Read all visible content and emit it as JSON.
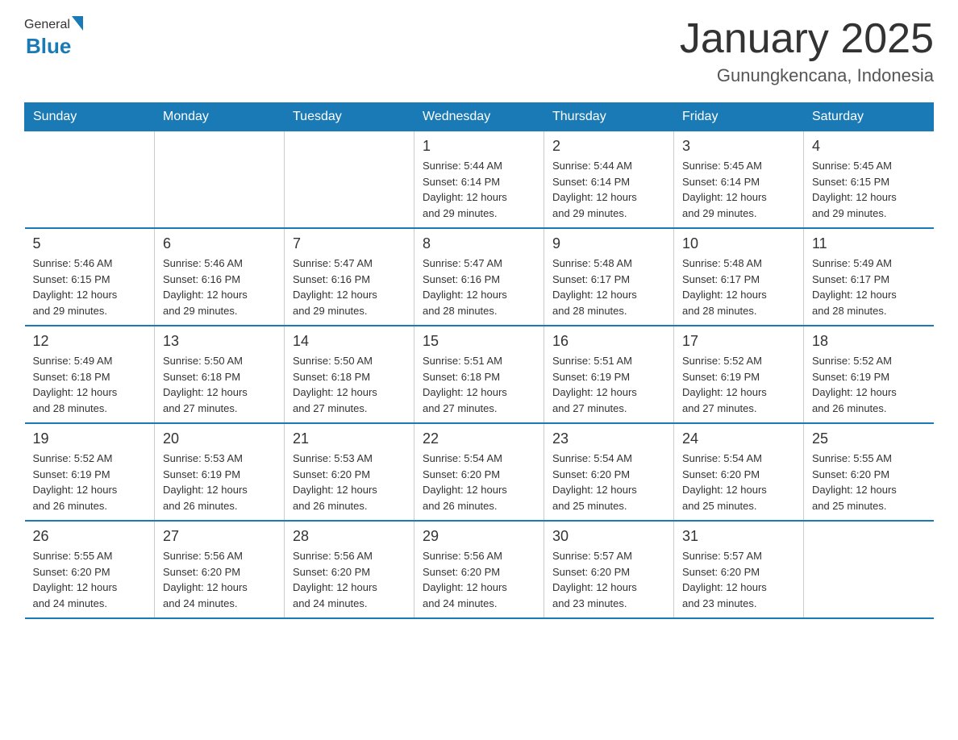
{
  "header": {
    "logo": {
      "general": "General",
      "arrow": true,
      "blue": "Blue"
    },
    "title": "January 2025",
    "location": "Gunungkencana, Indonesia"
  },
  "calendar": {
    "days_of_week": [
      "Sunday",
      "Monday",
      "Tuesday",
      "Wednesday",
      "Thursday",
      "Friday",
      "Saturday"
    ],
    "weeks": [
      [
        {
          "day": "",
          "info": ""
        },
        {
          "day": "",
          "info": ""
        },
        {
          "day": "",
          "info": ""
        },
        {
          "day": "1",
          "info": "Sunrise: 5:44 AM\nSunset: 6:14 PM\nDaylight: 12 hours\nand 29 minutes."
        },
        {
          "day": "2",
          "info": "Sunrise: 5:44 AM\nSunset: 6:14 PM\nDaylight: 12 hours\nand 29 minutes."
        },
        {
          "day": "3",
          "info": "Sunrise: 5:45 AM\nSunset: 6:14 PM\nDaylight: 12 hours\nand 29 minutes."
        },
        {
          "day": "4",
          "info": "Sunrise: 5:45 AM\nSunset: 6:15 PM\nDaylight: 12 hours\nand 29 minutes."
        }
      ],
      [
        {
          "day": "5",
          "info": "Sunrise: 5:46 AM\nSunset: 6:15 PM\nDaylight: 12 hours\nand 29 minutes."
        },
        {
          "day": "6",
          "info": "Sunrise: 5:46 AM\nSunset: 6:16 PM\nDaylight: 12 hours\nand 29 minutes."
        },
        {
          "day": "7",
          "info": "Sunrise: 5:47 AM\nSunset: 6:16 PM\nDaylight: 12 hours\nand 29 minutes."
        },
        {
          "day": "8",
          "info": "Sunrise: 5:47 AM\nSunset: 6:16 PM\nDaylight: 12 hours\nand 28 minutes."
        },
        {
          "day": "9",
          "info": "Sunrise: 5:48 AM\nSunset: 6:17 PM\nDaylight: 12 hours\nand 28 minutes."
        },
        {
          "day": "10",
          "info": "Sunrise: 5:48 AM\nSunset: 6:17 PM\nDaylight: 12 hours\nand 28 minutes."
        },
        {
          "day": "11",
          "info": "Sunrise: 5:49 AM\nSunset: 6:17 PM\nDaylight: 12 hours\nand 28 minutes."
        }
      ],
      [
        {
          "day": "12",
          "info": "Sunrise: 5:49 AM\nSunset: 6:18 PM\nDaylight: 12 hours\nand 28 minutes."
        },
        {
          "day": "13",
          "info": "Sunrise: 5:50 AM\nSunset: 6:18 PM\nDaylight: 12 hours\nand 27 minutes."
        },
        {
          "day": "14",
          "info": "Sunrise: 5:50 AM\nSunset: 6:18 PM\nDaylight: 12 hours\nand 27 minutes."
        },
        {
          "day": "15",
          "info": "Sunrise: 5:51 AM\nSunset: 6:18 PM\nDaylight: 12 hours\nand 27 minutes."
        },
        {
          "day": "16",
          "info": "Sunrise: 5:51 AM\nSunset: 6:19 PM\nDaylight: 12 hours\nand 27 minutes."
        },
        {
          "day": "17",
          "info": "Sunrise: 5:52 AM\nSunset: 6:19 PM\nDaylight: 12 hours\nand 27 minutes."
        },
        {
          "day": "18",
          "info": "Sunrise: 5:52 AM\nSunset: 6:19 PM\nDaylight: 12 hours\nand 26 minutes."
        }
      ],
      [
        {
          "day": "19",
          "info": "Sunrise: 5:52 AM\nSunset: 6:19 PM\nDaylight: 12 hours\nand 26 minutes."
        },
        {
          "day": "20",
          "info": "Sunrise: 5:53 AM\nSunset: 6:19 PM\nDaylight: 12 hours\nand 26 minutes."
        },
        {
          "day": "21",
          "info": "Sunrise: 5:53 AM\nSunset: 6:20 PM\nDaylight: 12 hours\nand 26 minutes."
        },
        {
          "day": "22",
          "info": "Sunrise: 5:54 AM\nSunset: 6:20 PM\nDaylight: 12 hours\nand 26 minutes."
        },
        {
          "day": "23",
          "info": "Sunrise: 5:54 AM\nSunset: 6:20 PM\nDaylight: 12 hours\nand 25 minutes."
        },
        {
          "day": "24",
          "info": "Sunrise: 5:54 AM\nSunset: 6:20 PM\nDaylight: 12 hours\nand 25 minutes."
        },
        {
          "day": "25",
          "info": "Sunrise: 5:55 AM\nSunset: 6:20 PM\nDaylight: 12 hours\nand 25 minutes."
        }
      ],
      [
        {
          "day": "26",
          "info": "Sunrise: 5:55 AM\nSunset: 6:20 PM\nDaylight: 12 hours\nand 24 minutes."
        },
        {
          "day": "27",
          "info": "Sunrise: 5:56 AM\nSunset: 6:20 PM\nDaylight: 12 hours\nand 24 minutes."
        },
        {
          "day": "28",
          "info": "Sunrise: 5:56 AM\nSunset: 6:20 PM\nDaylight: 12 hours\nand 24 minutes."
        },
        {
          "day": "29",
          "info": "Sunrise: 5:56 AM\nSunset: 6:20 PM\nDaylight: 12 hours\nand 24 minutes."
        },
        {
          "day": "30",
          "info": "Sunrise: 5:57 AM\nSunset: 6:20 PM\nDaylight: 12 hours\nand 23 minutes."
        },
        {
          "day": "31",
          "info": "Sunrise: 5:57 AM\nSunset: 6:20 PM\nDaylight: 12 hours\nand 23 minutes."
        },
        {
          "day": "",
          "info": ""
        }
      ]
    ]
  }
}
